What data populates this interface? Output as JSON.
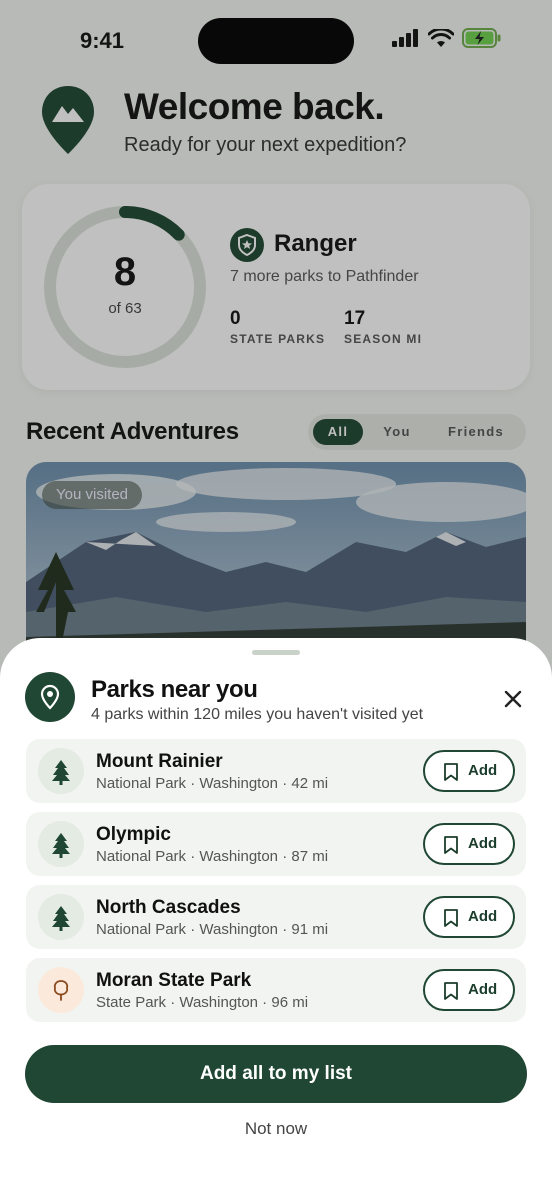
{
  "status_bar": {
    "time": "9:41"
  },
  "header": {
    "title": "Welcome back.",
    "subtitle": "Ready for your next expedition?"
  },
  "progress": {
    "visited": "8",
    "of_label": "of 63",
    "ring_fraction": 0.127,
    "rank": "Ranger",
    "next_rank_text": "7 more parks to Pathfinder",
    "stats": [
      {
        "value": "0",
        "label": "STATE PARKS"
      },
      {
        "value": "17",
        "label": "SEASON MI"
      }
    ]
  },
  "recent": {
    "title": "Recent Adventures",
    "filters": [
      "All",
      "You",
      "Friends"
    ],
    "active_filter": "All",
    "card_badge": "You visited"
  },
  "sheet": {
    "title": "Parks near you",
    "subtitle": "4 parks within 120 miles you haven't visited yet",
    "parks": [
      {
        "name": "Mount Rainier",
        "meta": "National Park · Washington · 42 mi",
        "icon": "pine-tree-icon",
        "add_label": "Add"
      },
      {
        "name": "Olympic",
        "meta": "National Park · Washington · 87 mi",
        "icon": "pine-tree-icon",
        "add_label": "Add"
      },
      {
        "name": "North Cascades",
        "meta": "National Park · Washington · 91 mi",
        "icon": "pine-tree-icon",
        "add_label": "Add"
      },
      {
        "name": "Moran State Park",
        "meta": "State Park · Washington · 96 mi",
        "icon": "deciduous-tree-icon",
        "add_label": "Add"
      }
    ],
    "primary_button": "Add all to my list",
    "secondary_button": "Not now"
  },
  "colors": {
    "brand": "#1f4733",
    "ring_track": "#dde3dc",
    "state_badge": "#fbeadb",
    "national_badge": "#e3ebe2"
  }
}
